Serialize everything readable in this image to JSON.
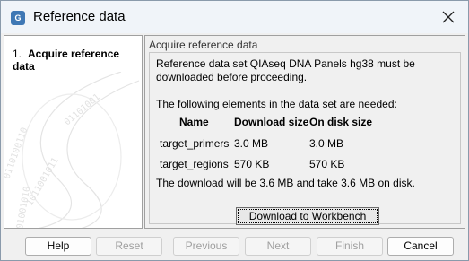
{
  "window": {
    "title": "Reference data",
    "app_icon": "CLC-app-icon",
    "close_icon": "close-icon"
  },
  "steps": [
    {
      "number": "1.",
      "label": "Acquire reference data",
      "active": true
    }
  ],
  "main": {
    "section_title": "Acquire reference data",
    "message": "Reference data set QIAseq DNA Panels hg38 must be downloaded before proceeding.",
    "needed_text": "The following elements in the data set are needed:",
    "table": {
      "headers": [
        "Name",
        "Download size",
        "On disk size"
      ],
      "rows": [
        [
          "target_primers",
          "3.0 MB",
          "3.0 MB"
        ],
        [
          "target_regions",
          "570 KB",
          "570 KB"
        ]
      ]
    },
    "download_note": "The download will be 3.6 MB and take 3.6 MB on disk.",
    "download_button": "Download to Workbench"
  },
  "buttons": {
    "help": "Help",
    "reset": "Reset",
    "previous": "Previous",
    "next": "Next",
    "finish": "Finish",
    "cancel": "Cancel"
  },
  "colors": {
    "titlebar": "#f0f4f9",
    "accent": "#3f78b5"
  }
}
